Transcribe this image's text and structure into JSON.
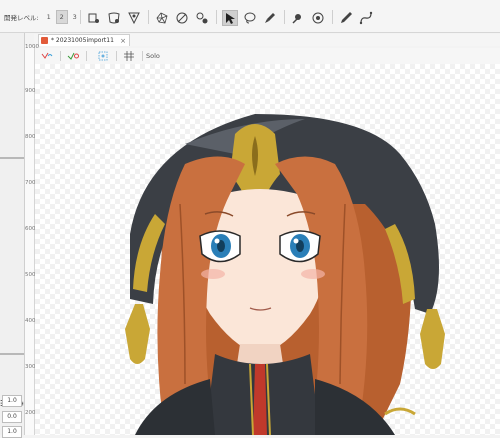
{
  "toolbar": {
    "display_level_label": "開発レベル:",
    "levels": [
      "1",
      "2",
      "3"
    ],
    "active_level": "2",
    "tools": [
      "deformer-icon",
      "warp-deformer-icon",
      "rotation-deformer-icon",
      "mesh-edit-icon",
      "mesh-auto-icon",
      "mesh-divide-icon",
      "arrow-select-icon",
      "lasso-icon",
      "brush-icon",
      "glue-icon",
      "skin-icon",
      "pen-icon",
      "curve-icon"
    ],
    "active_tool": "arrow-select-icon"
  },
  "document_tab": {
    "title": "* 20231005import11",
    "close": "×"
  },
  "viewbar": {
    "solo_label": "Solo"
  },
  "ruler": {
    "ticks": [
      "1000",
      "900",
      "800",
      "700",
      "600",
      "500",
      "400",
      "300",
      "200"
    ]
  },
  "left_panel": {
    "values": [
      "1.0",
      "0.0",
      "1.0"
    ],
    "icons": [
      "align-left-icon",
      "list-icon"
    ]
  },
  "colors": {
    "hair": "#c9703f",
    "hat": "#3b3f45",
    "gold": "#c9a736",
    "skin": "#fbe6d8",
    "eye": "#2a7fb8"
  }
}
